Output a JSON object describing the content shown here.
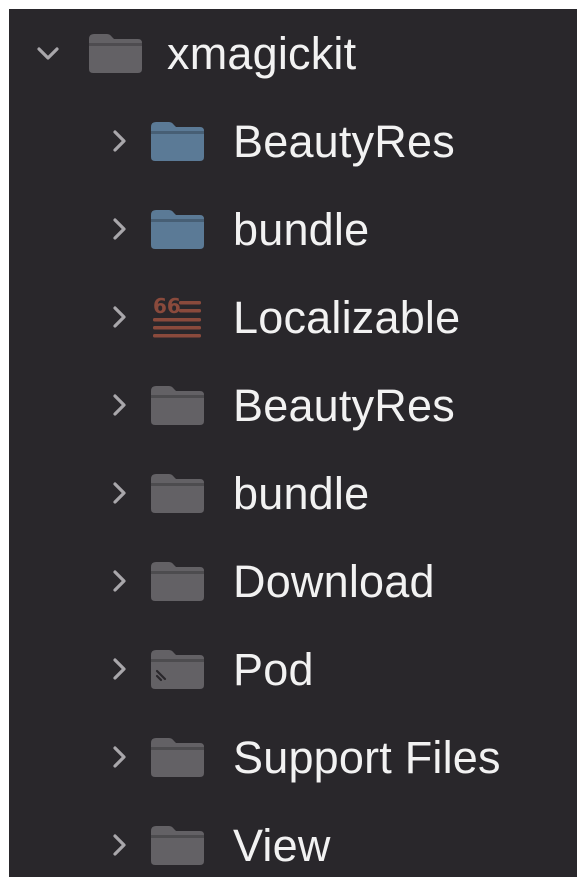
{
  "root": {
    "label": "xmagickit",
    "icon": "folder-icon",
    "expanded": true,
    "icon_color": "#636165"
  },
  "items": [
    {
      "label": "BeautyRes",
      "icon": "folder-icon",
      "icon_color": "#5b7a96",
      "expanded": false
    },
    {
      "label": "bundle",
      "icon": "folder-icon",
      "icon_color": "#5b7a96",
      "expanded": false
    },
    {
      "label": "Localizable",
      "icon": "strings-file-icon",
      "icon_color": "#8a4a3c",
      "expanded": false
    },
    {
      "label": "BeautyRes",
      "icon": "folder-icon",
      "icon_color": "#636165",
      "expanded": false
    },
    {
      "label": "bundle",
      "icon": "folder-icon",
      "icon_color": "#636165",
      "expanded": false
    },
    {
      "label": "Download",
      "icon": "folder-icon",
      "icon_color": "#636165",
      "expanded": false
    },
    {
      "label": "Pod",
      "icon": "pod-folder-icon",
      "icon_color": "#636165",
      "expanded": false
    },
    {
      "label": "Support Files",
      "icon": "folder-icon",
      "icon_color": "#636165",
      "expanded": false
    },
    {
      "label": "View",
      "icon": "folder-icon",
      "icon_color": "#636165",
      "expanded": false
    }
  ],
  "colors": {
    "background": "#29272b",
    "text": "#f2f2f2",
    "chevron": "#a9a7ab"
  }
}
